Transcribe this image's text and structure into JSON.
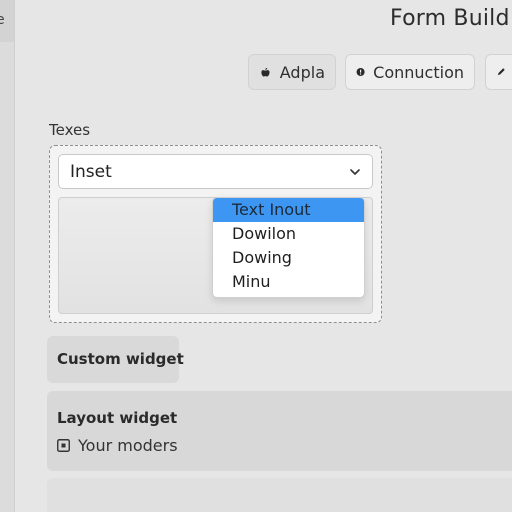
{
  "sidebar": {
    "tab_label": "e"
  },
  "header": {
    "title": "Form Build"
  },
  "toolbar": {
    "buttons": [
      {
        "label": "Adpla",
        "icon": "apple-icon"
      },
      {
        "label": "Connuction",
        "icon": "info-circle-icon"
      },
      {
        "label": "",
        "icon": "pencil-icon"
      }
    ]
  },
  "section": {
    "label": "Texes",
    "select_value": "Inset",
    "dropdown_options": [
      "Text Inout",
      "Dowilon",
      "Dowing",
      "Minu"
    ],
    "dropdown_active_index": 0
  },
  "widgets": {
    "custom": {
      "label": "Custom widget"
    },
    "layout": {
      "label": "Layout widget",
      "item_text": "Your moders",
      "item_icon": "square-dot-icon"
    }
  },
  "colors": {
    "accent": "#3d97f2"
  }
}
